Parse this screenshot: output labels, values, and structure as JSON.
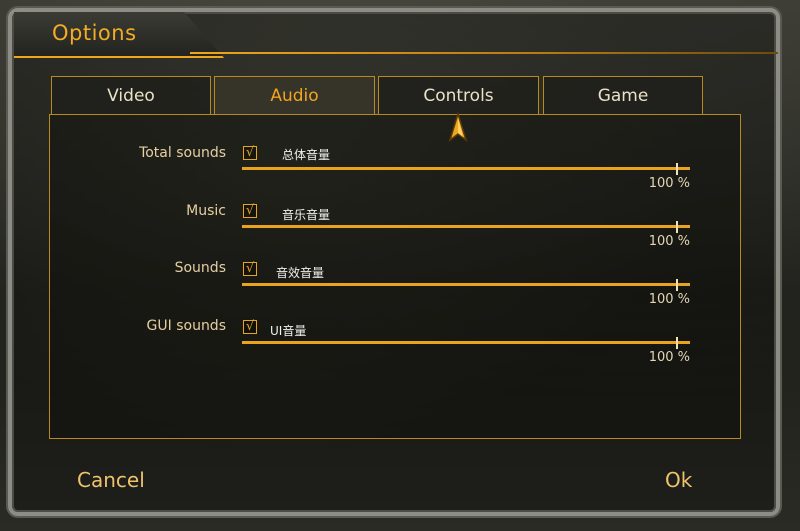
{
  "window": {
    "title": "Options"
  },
  "tabs": [
    {
      "label": "Video",
      "active": false
    },
    {
      "label": "Audio",
      "active": true
    },
    {
      "label": "Controls",
      "active": false
    },
    {
      "label": "Game",
      "active": false
    }
  ],
  "audio": {
    "rows": [
      {
        "label": "Total sounds",
        "checked": true,
        "check_mark": "√",
        "sublabel": "总体音量",
        "value_text": "100 %",
        "level": 1.0
      },
      {
        "label": "Music",
        "checked": true,
        "check_mark": "√",
        "sublabel": "音乐音量",
        "value_text": "100 %",
        "level": 1.0
      },
      {
        "label": "Sounds",
        "checked": true,
        "check_mark": "√",
        "sublabel": "音效音量",
        "value_text": "100 %",
        "level": 1.0
      },
      {
        "label": "GUI sounds",
        "checked": true,
        "check_mark": "√",
        "sublabel": "UI音量",
        "value_text": "100 %",
        "level": 1.0
      }
    ]
  },
  "footer": {
    "cancel_label": "Cancel",
    "ok_label": "Ok"
  },
  "colors": {
    "accent": "#f0a51e",
    "text": "#e6cfa2",
    "frame": "#8d8d86"
  },
  "icons": {
    "cursor": "arrow-cursor-icon"
  }
}
